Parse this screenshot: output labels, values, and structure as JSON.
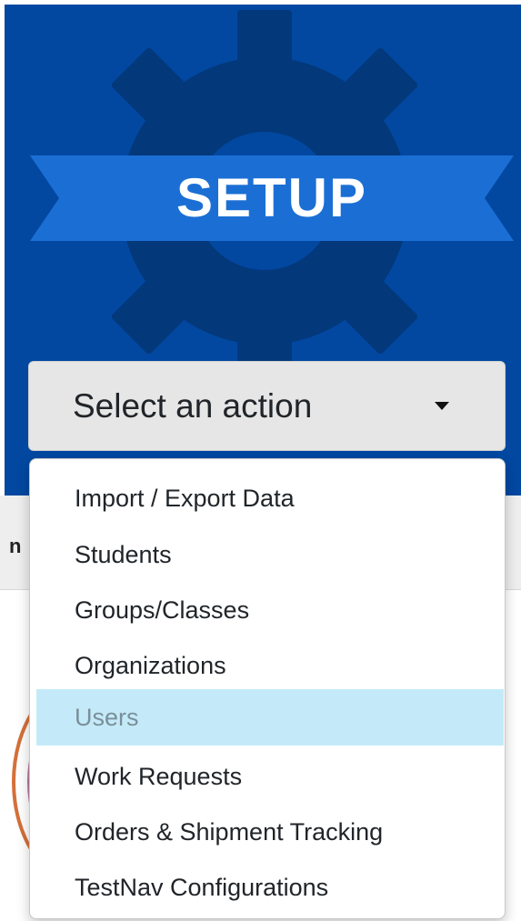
{
  "card": {
    "title": "SETUP",
    "background_color": "#0248a1",
    "gear_color": "#03387a",
    "banner_color": "#1b6fd4"
  },
  "action_select": {
    "selected_label": "Select an action"
  },
  "peek": {
    "text": "n"
  },
  "menu": {
    "items": [
      {
        "label": "Import / Export Data"
      },
      {
        "label": "Students"
      },
      {
        "label": "Groups/Classes"
      },
      {
        "label": "Organizations"
      },
      {
        "label": "Users",
        "state": "hover"
      },
      {
        "label": "Work Requests"
      },
      {
        "label": "Orders & Shipment Tracking"
      },
      {
        "label": "TestNav Configurations"
      }
    ],
    "hover_color": "#c4eaf9"
  }
}
